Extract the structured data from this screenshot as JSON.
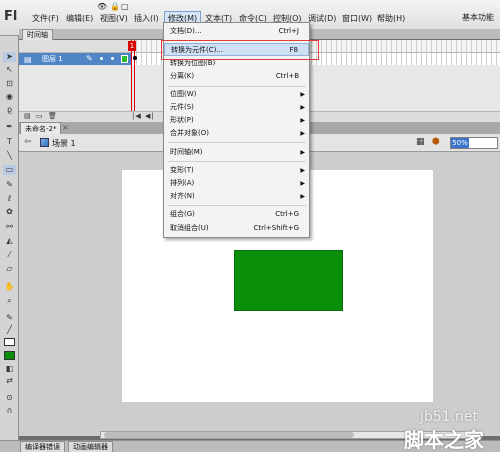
{
  "app": {
    "logo": "Fl",
    "workspace": "基本功能"
  },
  "menubar": {
    "items": [
      {
        "label": "文件(F)"
      },
      {
        "label": "编辑(E)"
      },
      {
        "label": "视图(V)"
      },
      {
        "label": "插入(I)"
      },
      {
        "label": "修改(M)"
      },
      {
        "label": "文本(T)"
      },
      {
        "label": "命令(C)"
      },
      {
        "label": "控制(O)"
      },
      {
        "label": "调试(D)"
      },
      {
        "label": "窗口(W)"
      },
      {
        "label": "帮助(H)"
      }
    ],
    "active": "修改(M)"
  },
  "timeline": {
    "tab_label": "时间轴",
    "layer_name": "图层 1",
    "playhead_frame": "1"
  },
  "document": {
    "tab_label": "未命名-2*",
    "close_glyph": "×",
    "scene_label": "场景 1",
    "zoom": "50%"
  },
  "stage": {
    "rect_color": "#0b8f0b"
  },
  "modify_menu": {
    "items": [
      {
        "label": "文档(D)...",
        "shortcut": "Ctrl+J"
      },
      {
        "label": "转换为元件(C)...",
        "shortcut": "F8",
        "highlighted": true
      },
      {
        "label": "转换为位图(B)",
        "shortcut": ""
      },
      {
        "label": "分离(K)",
        "shortcut": "Ctrl+B"
      },
      {
        "label": "位图(W)",
        "submenu": true
      },
      {
        "label": "元件(S)",
        "submenu": true
      },
      {
        "label": "形状(P)",
        "submenu": true
      },
      {
        "label": "合并对象(O)",
        "submenu": true
      },
      {
        "label": "时间轴(M)",
        "submenu": true
      },
      {
        "label": "变形(T)",
        "submenu": true
      },
      {
        "label": "排列(A)",
        "submenu": true
      },
      {
        "label": "对齐(N)",
        "submenu": true
      },
      {
        "label": "组合(G)",
        "shortcut": "Ctrl+G"
      },
      {
        "label": "取消组合(U)",
        "shortcut": "Ctrl+Shift+G"
      }
    ]
  },
  "bottom_tabs": [
    "编译器错误",
    "动画编辑器"
  ],
  "watermark": {
    "line1": "jb51.net",
    "line2": "脚本之家"
  },
  "colors": {
    "accent": "#4f84c5",
    "highlight_box": "#e03a3a",
    "fill": "#0b8f0b"
  }
}
